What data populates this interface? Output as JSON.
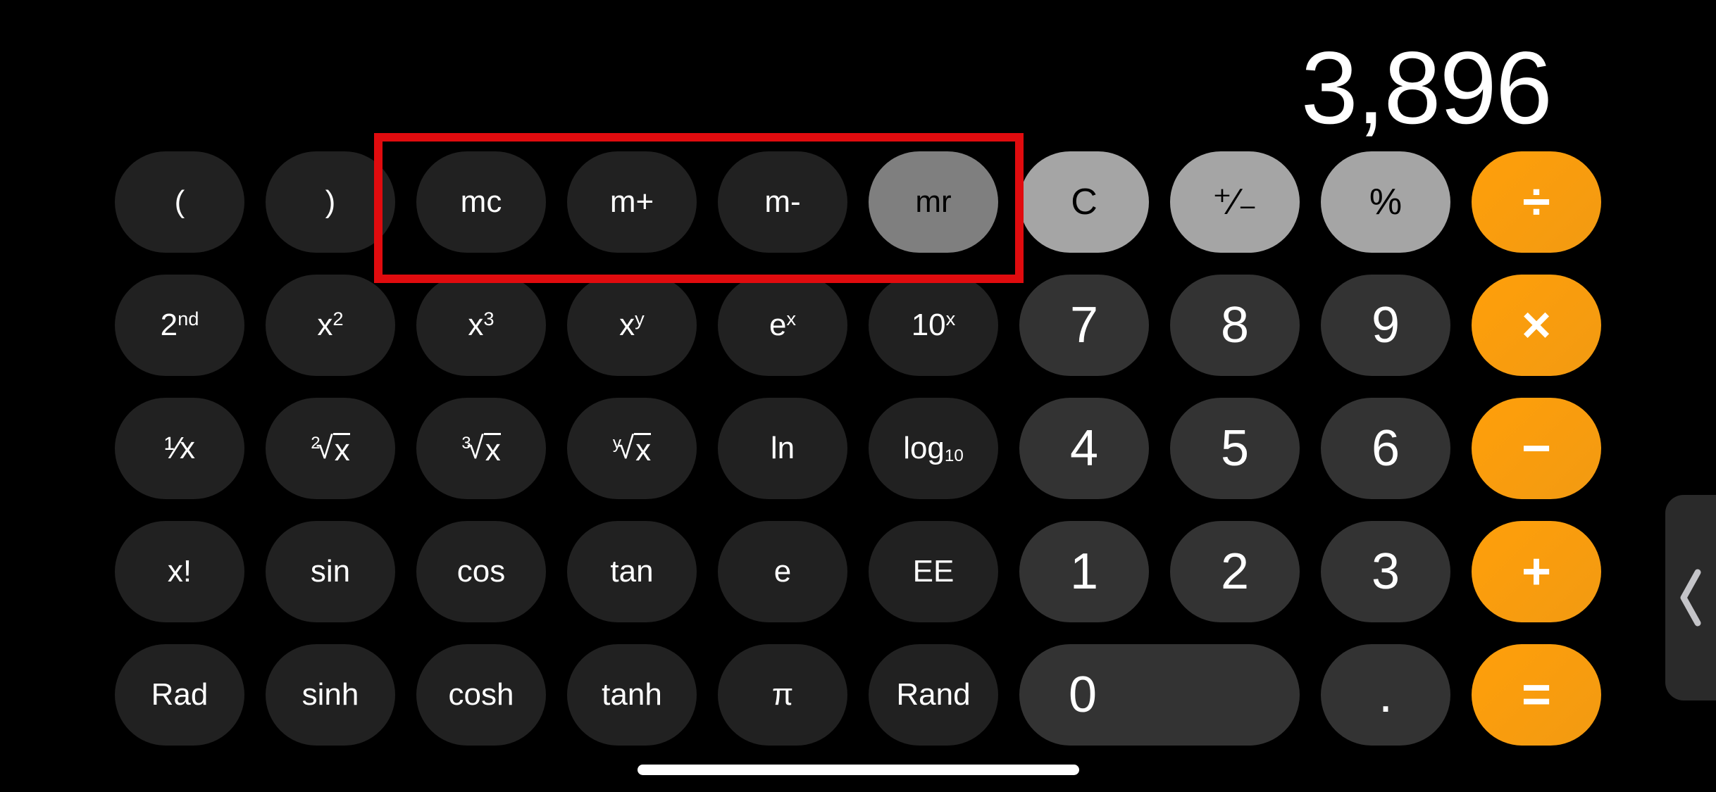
{
  "display": {
    "value": "3,896"
  },
  "colors": {
    "background": "#000000",
    "function_key": "#212121",
    "digit_key": "#333333",
    "utility_key": "#a5a5a5",
    "active_memory_key": "#7f7f7f",
    "operator_key": "#ff9f0a",
    "highlight_box": "#e00b0e"
  },
  "keys": {
    "open_paren": "(",
    "close_paren": ")",
    "mc": "mc",
    "m_plus": "m+",
    "m_minus": "m-",
    "mr": "mr",
    "clear": "C",
    "sign": "⁺∕₋",
    "percent": "%",
    "divide": "÷",
    "second_base": "2",
    "second_sup": "nd",
    "x_squared_base": "x",
    "x_squared_sup": "2",
    "x_cubed_base": "x",
    "x_cubed_sup": "3",
    "x_pow_y_base": "x",
    "x_pow_y_sup": "y",
    "e_pow_x_base": "e",
    "e_pow_x_sup": "x",
    "ten_pow_x_base": "10",
    "ten_pow_x_sup": "x",
    "seven": "7",
    "eight": "8",
    "nine": "9",
    "multiply": "×",
    "reciprocal": "¹⁄x",
    "sqrt_index": "2",
    "cbrt_index": "3",
    "yroot_index": "y",
    "radical_symbol": "√",
    "radical_arg": "x",
    "ln": "ln",
    "log10_base": "log",
    "log10_sub": "10",
    "four": "4",
    "five": "5",
    "six": "6",
    "subtract": "−",
    "factorial": "x!",
    "sin": "sin",
    "cos": "cos",
    "tan": "tan",
    "e": "e",
    "ee": "EE",
    "one": "1",
    "two": "2",
    "three": "3",
    "add": "+",
    "rad": "Rad",
    "sinh": "sinh",
    "cosh": "cosh",
    "tanh": "tanh",
    "pi": "π",
    "rand": "Rand",
    "zero": "0",
    "decimal": ".",
    "equals": "="
  },
  "side_panel": {
    "icon": "chevron-left-icon"
  },
  "annotation": {
    "label": "memory-keys-highlight"
  }
}
